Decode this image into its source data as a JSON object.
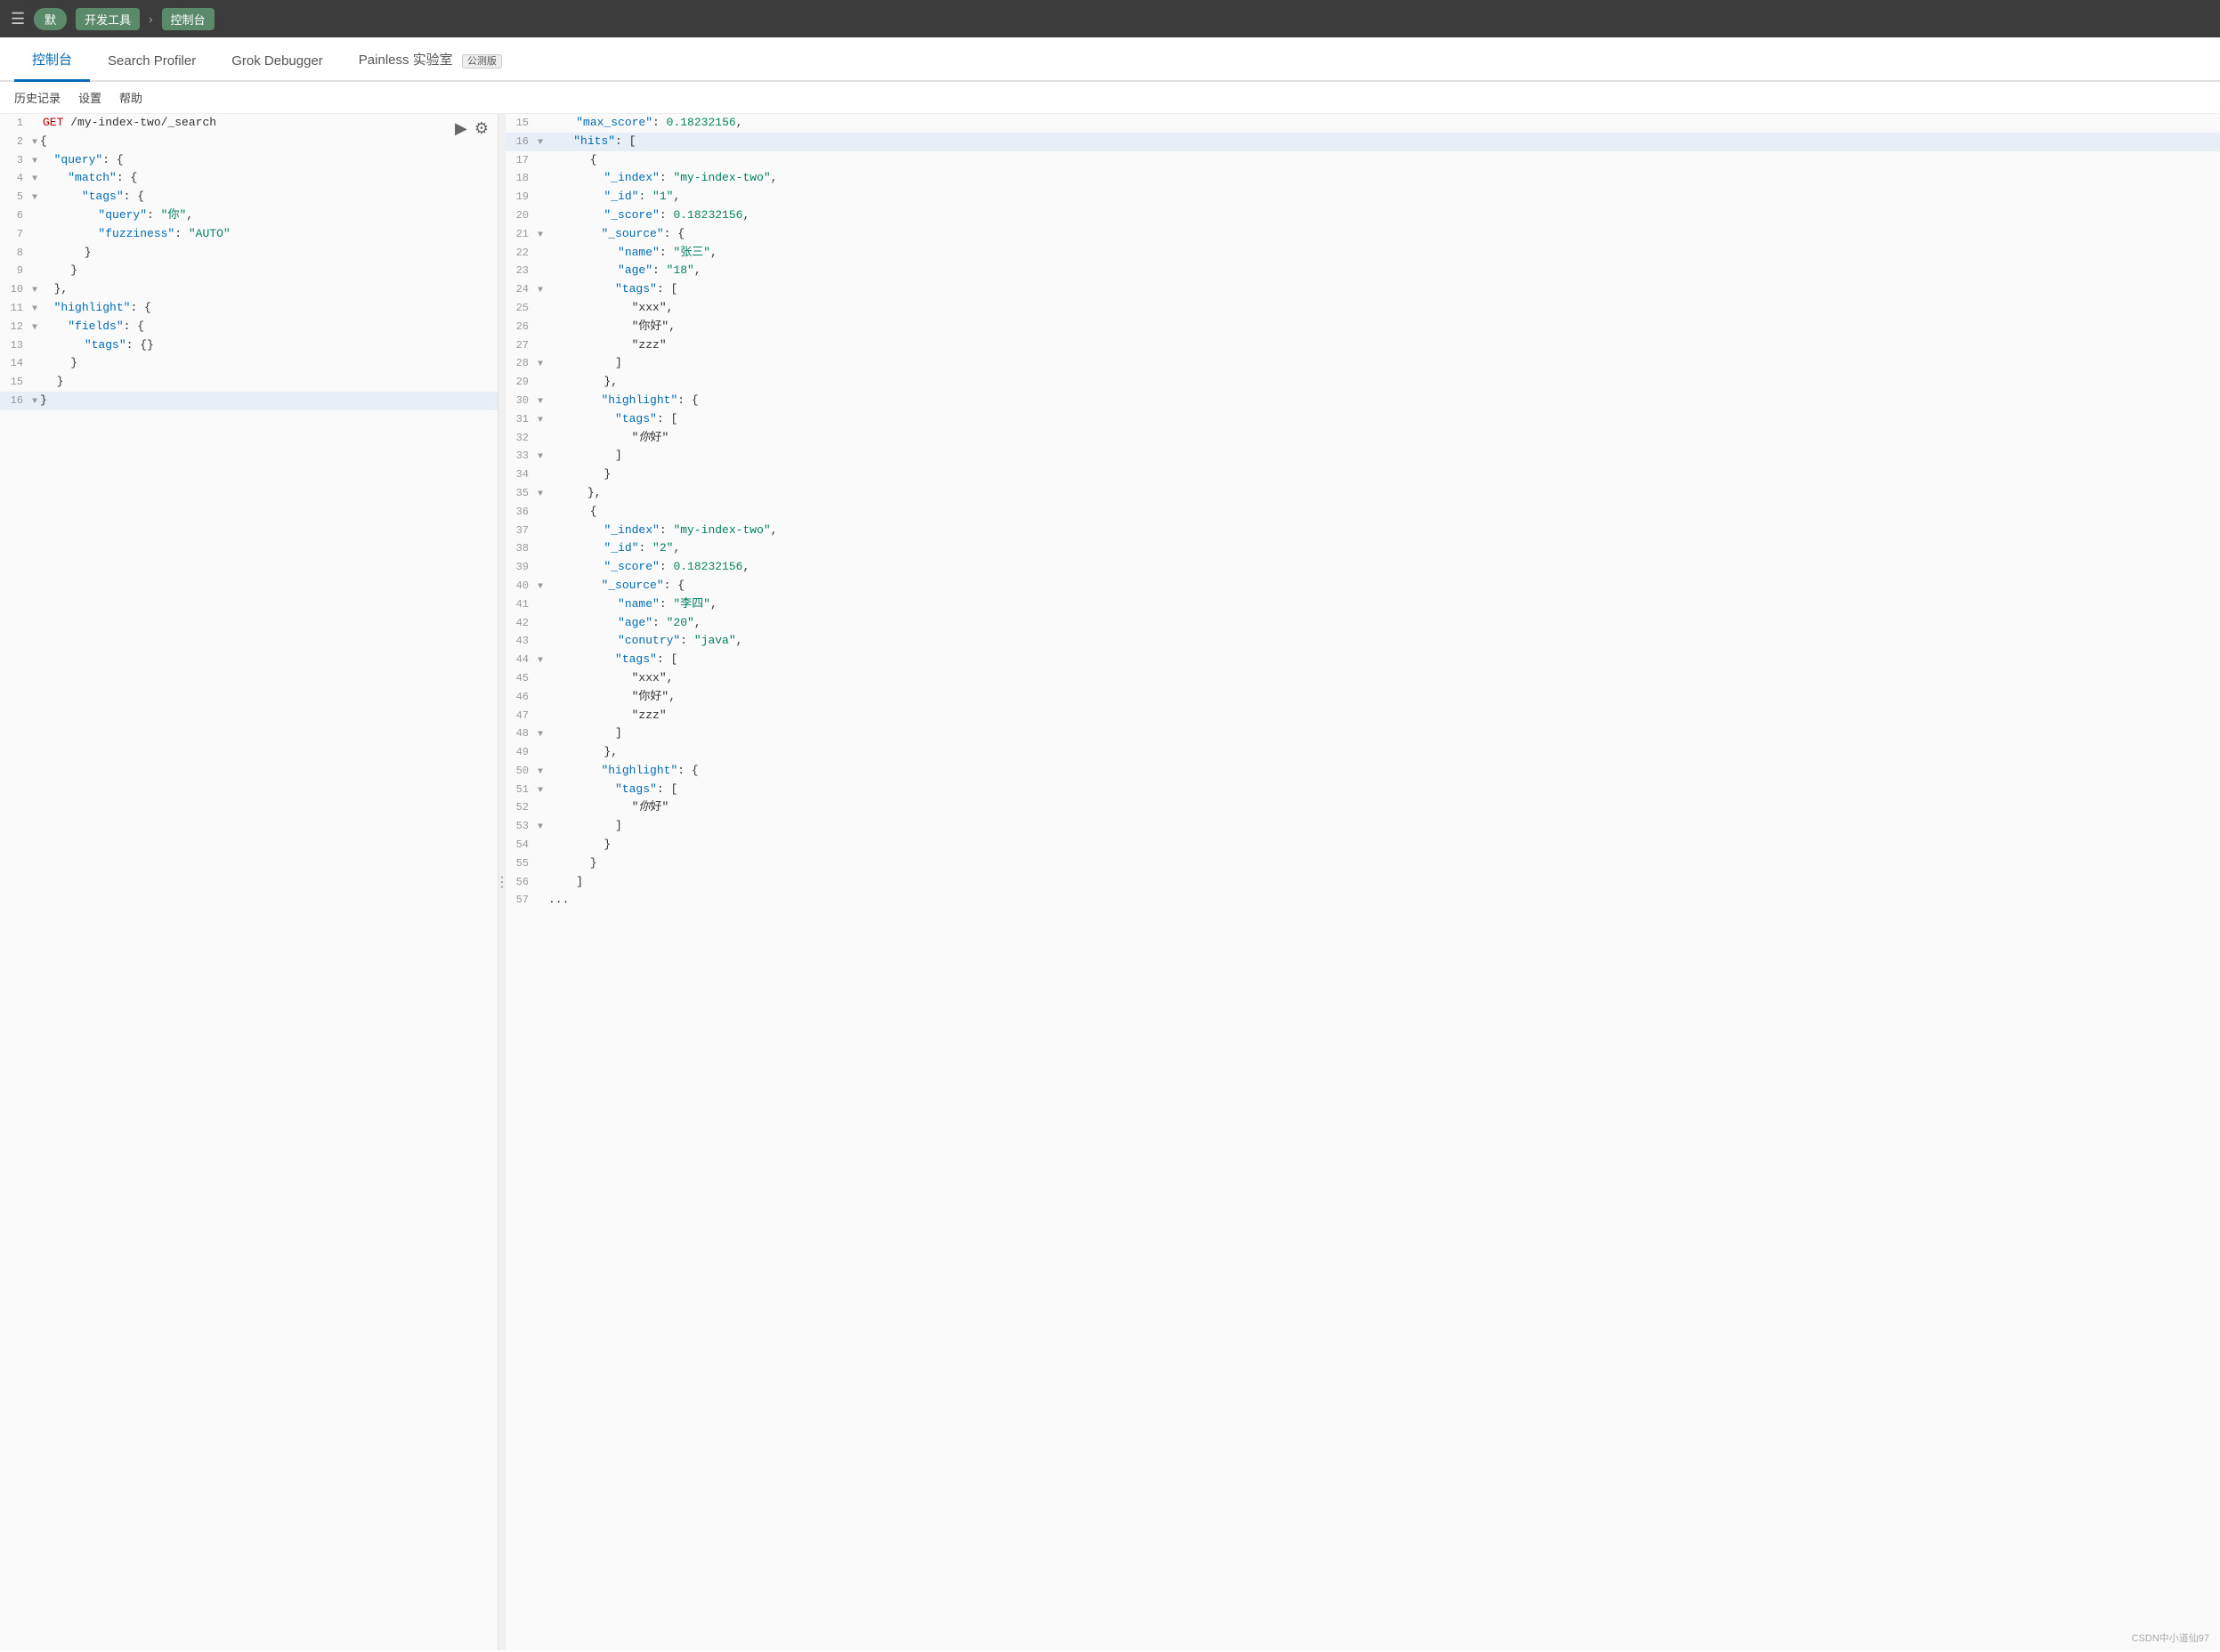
{
  "browser": {
    "menu_icon": "☰",
    "tab_pill": "默",
    "breadcrumb1": "开发工具",
    "breadcrumb_arrow": "›",
    "breadcrumb2": "控制台"
  },
  "nav": {
    "tabs": [
      {
        "label": "控制台",
        "active": true
      },
      {
        "label": "Search Profiler",
        "active": false
      },
      {
        "label": "Grok Debugger",
        "active": false
      },
      {
        "label": "Painless 实验室",
        "active": false
      }
    ],
    "badge": "公测版"
  },
  "toolbar": {
    "history": "历史记录",
    "settings": "设置",
    "help": "帮助"
  },
  "editor": {
    "run_title": "▶",
    "copy_title": "⚙",
    "lines": [
      {
        "num": "1",
        "content": "GET /my-index-two/_search",
        "type": "request",
        "indent": ""
      },
      {
        "num": "2",
        "content": "{",
        "type": "punct",
        "indent": "",
        "fold": "▼"
      },
      {
        "num": "3",
        "content": "  \"query\": {",
        "type": "key",
        "indent": "  ",
        "fold": "▼"
      },
      {
        "num": "4",
        "content": "    \"match\": {",
        "type": "key",
        "indent": "    ",
        "fold": "▼"
      },
      {
        "num": "5",
        "content": "      \"tags\": {",
        "type": "key",
        "indent": "      ",
        "fold": "▼"
      },
      {
        "num": "6",
        "content": "        \"query\": \"你\",",
        "type": "keystr",
        "indent": "        "
      },
      {
        "num": "7",
        "content": "        \"fuzziness\": \"AUTO\"",
        "type": "keystr",
        "indent": "        "
      },
      {
        "num": "8",
        "content": "      }",
        "type": "punct",
        "indent": "      "
      },
      {
        "num": "9",
        "content": "    }",
        "type": "punct",
        "indent": "    "
      },
      {
        "num": "10",
        "content": "  },",
        "type": "punct",
        "indent": "  ",
        "fold": "▼"
      },
      {
        "num": "11",
        "content": "  \"highlight\": {",
        "type": "key",
        "indent": "  ",
        "fold": "▼"
      },
      {
        "num": "12",
        "content": "    \"fields\": {",
        "type": "key",
        "indent": "    ",
        "fold": "▼"
      },
      {
        "num": "13",
        "content": "      \"tags\": {}",
        "type": "key",
        "indent": "      "
      },
      {
        "num": "14",
        "content": "    }",
        "type": "punct",
        "indent": "    "
      },
      {
        "num": "15",
        "content": "  }",
        "type": "punct",
        "indent": "  "
      },
      {
        "num": "16",
        "content": "}",
        "type": "punct",
        "indent": "",
        "fold": "▼",
        "highlighted": true
      }
    ]
  },
  "response": {
    "lines": [
      {
        "num": "15",
        "content": "    \"max_score\": 0.18232156,",
        "indent": "    "
      },
      {
        "num": "16",
        "content": "    \"hits\": [",
        "indent": "    ",
        "fold": "▼",
        "highlighted": true
      },
      {
        "num": "17",
        "content": "      {",
        "indent": "      "
      },
      {
        "num": "18",
        "content": "        \"_index\": \"my-index-two\",",
        "indent": "        "
      },
      {
        "num": "19",
        "content": "        \"_id\": \"1\",",
        "indent": "        "
      },
      {
        "num": "20",
        "content": "        \"_score\": 0.18232156,",
        "indent": "        "
      },
      {
        "num": "21",
        "content": "        \"_source\": {",
        "indent": "        ",
        "fold": "▼"
      },
      {
        "num": "22",
        "content": "          \"name\": \"张三\",",
        "indent": "          "
      },
      {
        "num": "23",
        "content": "          \"age\": \"18\",",
        "indent": "          "
      },
      {
        "num": "24",
        "content": "          \"tags\": [",
        "indent": "          ",
        "fold": "▼"
      },
      {
        "num": "25",
        "content": "            \"xxx\",",
        "indent": "            "
      },
      {
        "num": "26",
        "content": "            \"你好\",",
        "indent": "            "
      },
      {
        "num": "27",
        "content": "            \"zzz\"",
        "indent": "            "
      },
      {
        "num": "28",
        "content": "          ]",
        "indent": "          ",
        "fold": "▼"
      },
      {
        "num": "29",
        "content": "        },",
        "indent": "        "
      },
      {
        "num": "30",
        "content": "        \"highlight\": {",
        "indent": "        ",
        "fold": "▼"
      },
      {
        "num": "31",
        "content": "          \"tags\": [",
        "indent": "          ",
        "fold": "▼"
      },
      {
        "num": "32",
        "content": "            \"<em>你</em>好\"",
        "indent": "            "
      },
      {
        "num": "33",
        "content": "          ]",
        "indent": "          ",
        "fold": "▼"
      },
      {
        "num": "34",
        "content": "        }",
        "indent": "        "
      },
      {
        "num": "35",
        "content": "      },",
        "indent": "      ",
        "fold": "▼"
      },
      {
        "num": "36",
        "content": "      {",
        "indent": "      "
      },
      {
        "num": "37",
        "content": "        \"_index\": \"my-index-two\",",
        "indent": "        "
      },
      {
        "num": "38",
        "content": "        \"_id\": \"2\",",
        "indent": "        "
      },
      {
        "num": "39",
        "content": "        \"_score\": 0.18232156,",
        "indent": "        "
      },
      {
        "num": "40",
        "content": "        \"_source\": {",
        "indent": "        ",
        "fold": "▼"
      },
      {
        "num": "41",
        "content": "          \"name\": \"李四\",",
        "indent": "          "
      },
      {
        "num": "42",
        "content": "          \"age\": \"20\",",
        "indent": "          "
      },
      {
        "num": "43",
        "content": "          \"conutry\": \"java\",",
        "indent": "          "
      },
      {
        "num": "44",
        "content": "          \"tags\": [",
        "indent": "          ",
        "fold": "▼"
      },
      {
        "num": "45",
        "content": "            \"xxx\",",
        "indent": "            "
      },
      {
        "num": "46",
        "content": "            \"你好\",",
        "indent": "            "
      },
      {
        "num": "47",
        "content": "            \"zzz\"",
        "indent": "            "
      },
      {
        "num": "48",
        "content": "          ]",
        "indent": "          ",
        "fold": "▼"
      },
      {
        "num": "49",
        "content": "        },",
        "indent": "        "
      },
      {
        "num": "50",
        "content": "        \"highlight\": {",
        "indent": "        ",
        "fold": "▼"
      },
      {
        "num": "51",
        "content": "          \"tags\": [",
        "indent": "          ",
        "fold": "▼"
      },
      {
        "num": "52",
        "content": "            \"<em>你</em>好\"",
        "indent": "            "
      },
      {
        "num": "53",
        "content": "          ]",
        "indent": "          ",
        "fold": "▼"
      },
      {
        "num": "54",
        "content": "        }",
        "indent": "        "
      },
      {
        "num": "55",
        "content": "      }",
        "indent": "      "
      },
      {
        "num": "56",
        "content": "    ]",
        "indent": "    "
      },
      {
        "num": "57",
        "content": "...",
        "indent": "  "
      }
    ]
  },
  "watermark": "CSDN中小道仙97"
}
